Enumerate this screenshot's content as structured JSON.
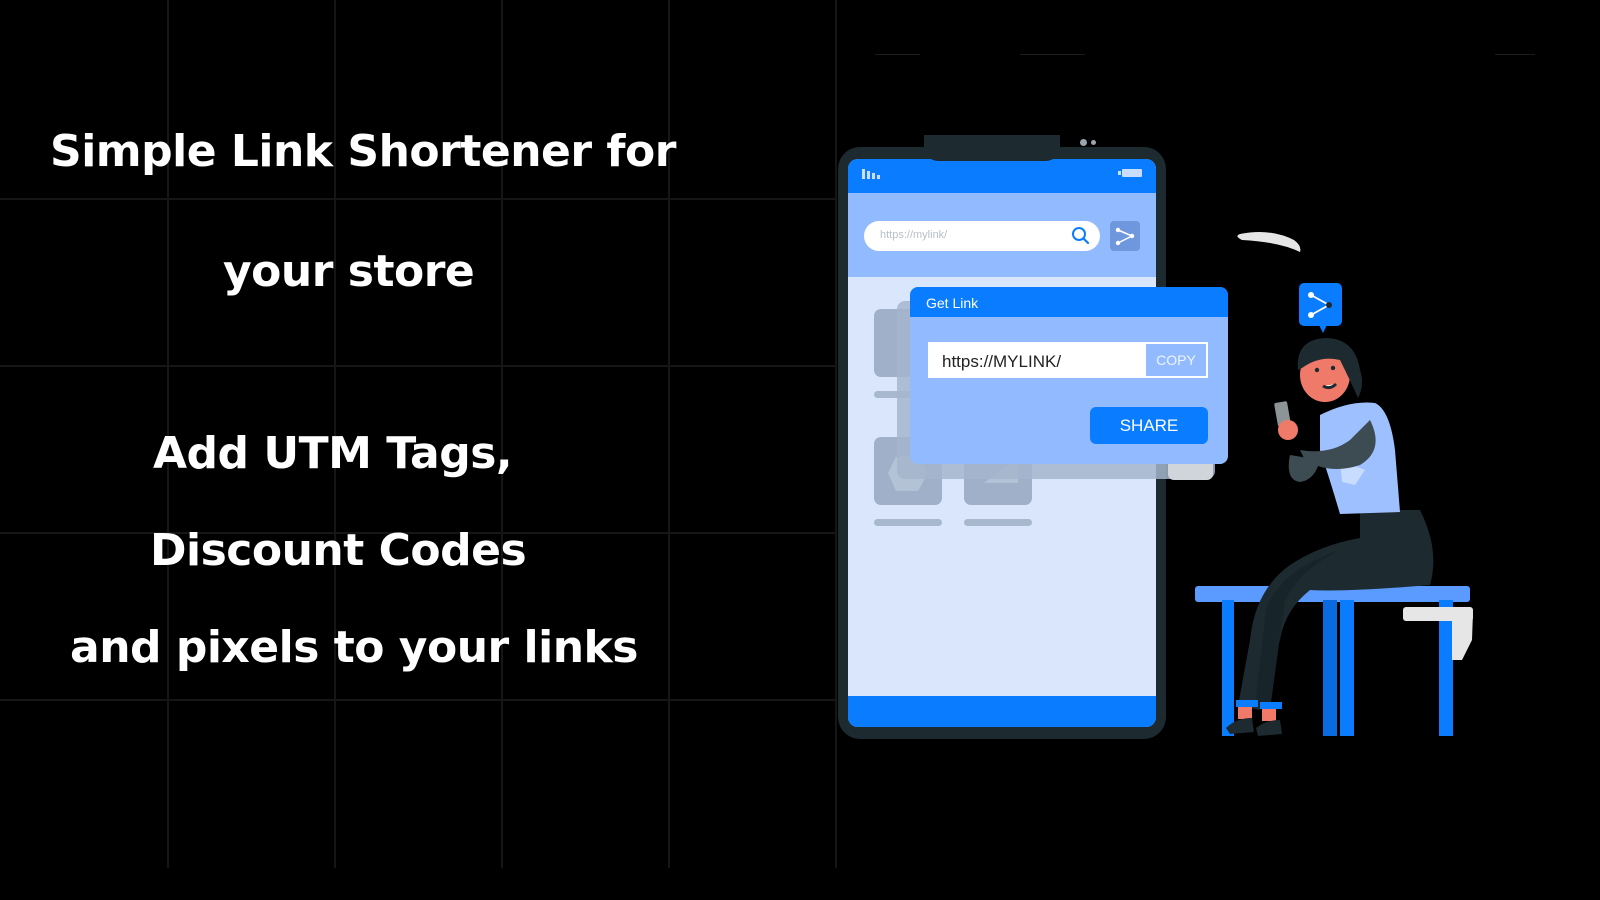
{
  "headline": {
    "line1": "Simple Link Shortener for",
    "line2": "your store"
  },
  "subheadline": {
    "line1": "Add UTM Tags,",
    "line2": "Discount Codes",
    "line3": "and pixels to your links"
  },
  "phone": {
    "search_placeholder": "https://mylink/",
    "search_icon": "search-icon",
    "share_icon": "share-icon"
  },
  "dialog": {
    "title": "Get Link",
    "link_value": "https://MYLINK/",
    "copy_label": "COPY",
    "share_label": "SHARE"
  },
  "colors": {
    "background": "#000000",
    "accent": "#0a7cff",
    "light_blue": "#92bbff",
    "screen_bg": "#d9e6fc",
    "phone_frame": "#1d2a30"
  }
}
